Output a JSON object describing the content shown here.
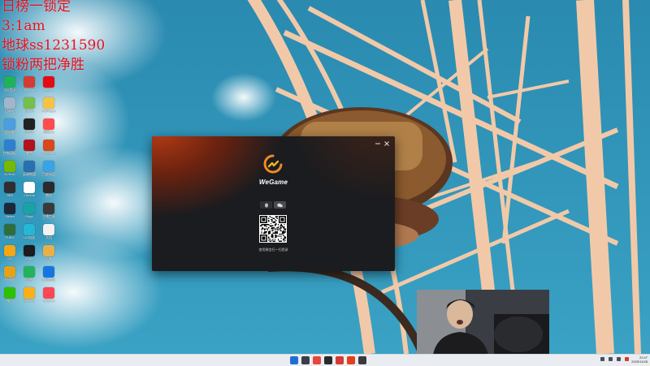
{
  "overlay": {
    "line1": "日榜一锁定",
    "line2": "3:1am",
    "line3": "地球ss1231590",
    "line4": "锁粉两把净胜"
  },
  "desktop_icons": [
    {
      "label": "QQ音乐",
      "color": "#1fb25a",
      "icon": "music-icon"
    },
    {
      "label": "网易云",
      "color": "#d43c33",
      "icon": "cloud-music-icon"
    },
    {
      "label": "Netflix",
      "color": "#e50914",
      "icon": "netflix-icon"
    },
    {
      "label": "回收站",
      "color": "#9fb6cc",
      "icon": "recycle-bin-icon"
    },
    {
      "label": "KOOK",
      "color": "#74c04b",
      "icon": "kook-icon"
    },
    {
      "label": "PotPlayer",
      "color": "#f6c343",
      "icon": "player-icon"
    },
    {
      "label": "此电脑",
      "color": "#4d9de0",
      "icon": "computer-icon"
    },
    {
      "label": "小黑盒",
      "color": "#222222",
      "icon": "heybox-icon"
    },
    {
      "label": "网易UU",
      "color": "#ff4d4f",
      "icon": "uu-icon"
    },
    {
      "label": "控制面板",
      "color": "#2f7fd1",
      "icon": "control-panel-icon"
    },
    {
      "label": "暴雪",
      "color": "#b3121a",
      "icon": "battlenet-icon"
    },
    {
      "label": "WeGame",
      "color": "#d9481b",
      "icon": "wegame-icon"
    },
    {
      "label": "NVIDIA",
      "color": "#76b900",
      "icon": "nvidia-icon"
    },
    {
      "label": "英雄联盟",
      "color": "#2a6fb0",
      "icon": "lol-icon"
    },
    {
      "label": "百度网盘",
      "color": "#3aa3e3",
      "icon": "netdisk-icon"
    },
    {
      "label": "OBS",
      "color": "#302e31",
      "icon": "obs-icon"
    },
    {
      "label": "Chrome",
      "color": "#ffffff",
      "icon": "chrome-icon"
    },
    {
      "label": "雷电",
      "color": "#2b2b2b",
      "icon": "emulator-icon"
    },
    {
      "label": "Steam",
      "color": "#1b2838",
      "icon": "steam-icon"
    },
    {
      "label": "Edge",
      "color": "#1aa3a3",
      "icon": "edge-icon"
    },
    {
      "label": "主播工具",
      "color": "#3a3a3a",
      "icon": "tool-icon"
    },
    {
      "label": "PUBG",
      "color": "#2e6e3e",
      "icon": "pubg-icon"
    },
    {
      "label": "UU加速",
      "color": "#25b7d3",
      "icon": "accelerator-icon"
    },
    {
      "label": "文档",
      "color": "#f2f2f2",
      "icon": "document-icon"
    },
    {
      "label": "GG",
      "color": "#f2a618",
      "icon": "gg-icon"
    },
    {
      "label": "Epic",
      "color": "#1c1c1c",
      "icon": "epic-icon"
    },
    {
      "label": "王者",
      "color": "#e8b04a",
      "icon": "game-icon"
    },
    {
      "label": "加速器",
      "color": "#e3a21a",
      "icon": "speed-icon"
    },
    {
      "label": "迅雷",
      "color": "#23b35c",
      "icon": "thunder-icon"
    },
    {
      "label": "腾讯会议",
      "color": "#1676e0",
      "icon": "meeting-icon"
    },
    {
      "label": "微信",
      "color": "#2dc100",
      "icon": "wechat-icon"
    },
    {
      "label": "Rockstar",
      "color": "#fcaf17",
      "icon": "rockstar-icon"
    },
    {
      "label": "Valorant",
      "color": "#ff4655",
      "icon": "valorant-icon"
    }
  ],
  "wegame": {
    "logo_text": "WeGame",
    "hint": "使用微信扫一扫登录",
    "accent": "#f08a24",
    "tabs": [
      {
        "icon": "qq-icon"
      },
      {
        "icon": "wechat-icon"
      }
    ]
  },
  "taskbar": {
    "apps": [
      {
        "icon": "windows-start-icon",
        "color": "#1f6fd0"
      },
      {
        "icon": "search-icon",
        "color": "#3a3f47"
      },
      {
        "icon": "chrome-icon",
        "color": "#e8483b"
      },
      {
        "icon": "obs-icon",
        "color": "#2a2a2a"
      },
      {
        "icon": "netease-icon",
        "color": "#d43c33"
      },
      {
        "icon": "wegame-icon",
        "color": "#e0401b"
      },
      {
        "icon": "video-icon",
        "color": "#3b3b3b"
      }
    ],
    "clock_time": "22:47",
    "clock_date": "2025/11/28"
  }
}
